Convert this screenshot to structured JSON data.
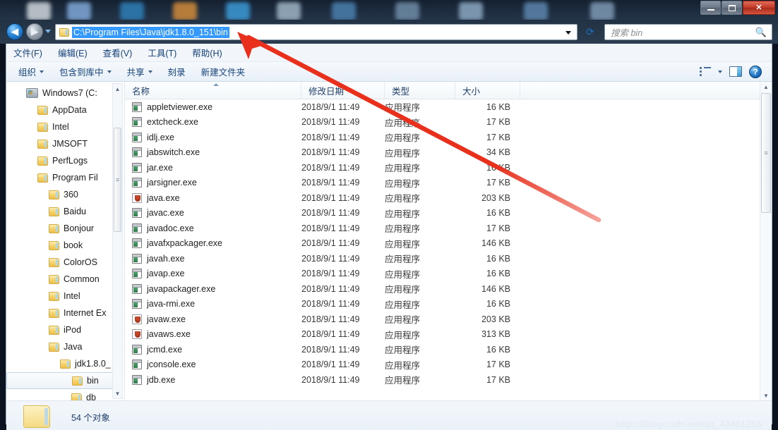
{
  "window": {
    "controls": {
      "minimize": "–",
      "maximize": "❐",
      "close": "✕"
    }
  },
  "address_bar": {
    "back_label": "◀",
    "forward_label": "▶",
    "path": "C:\\Program Files\\Java\\jdk1.8.0_151\\bin",
    "refresh_label": "⟳",
    "folder_icon": "folder-icon",
    "dropdown_icon": "chevron-down-icon"
  },
  "search": {
    "placeholder": "搜索 bin",
    "icon": "search-icon"
  },
  "menu": {
    "items": [
      {
        "label": "文件(F)"
      },
      {
        "label": "编辑(E)"
      },
      {
        "label": "查看(V)"
      },
      {
        "label": "工具(T)"
      },
      {
        "label": "帮助(H)"
      }
    ]
  },
  "toolbar": {
    "items": [
      {
        "label": "组织",
        "caret": true
      },
      {
        "label": "包含到库中",
        "caret": true
      },
      {
        "label": "共享",
        "caret": true
      },
      {
        "label": "刻录",
        "caret": false
      },
      {
        "label": "新建文件夹",
        "caret": false
      }
    ],
    "view_icon": "view-list-icon",
    "view_caret": "chevron-down-icon",
    "preview_pane_icon": "preview-pane-icon",
    "help_icon": "help-icon",
    "help_glyph": "?"
  },
  "sidebar": {
    "items": [
      {
        "label": "Windows7 (C:",
        "type": "drive",
        "indent": 0,
        "selected": false
      },
      {
        "label": "AppData",
        "type": "folder",
        "indent": 1,
        "selected": false
      },
      {
        "label": "Intel",
        "type": "folder",
        "indent": 1,
        "selected": false
      },
      {
        "label": "JMSOFT",
        "type": "folder",
        "indent": 1,
        "selected": false
      },
      {
        "label": "PerfLogs",
        "type": "folder",
        "indent": 1,
        "selected": false
      },
      {
        "label": "Program Fil",
        "type": "folder",
        "indent": 1,
        "selected": false
      },
      {
        "label": "360",
        "type": "folder",
        "indent": 2,
        "selected": false
      },
      {
        "label": "Baidu",
        "type": "folder",
        "indent": 2,
        "selected": false
      },
      {
        "label": "Bonjour",
        "type": "folder",
        "indent": 2,
        "selected": false
      },
      {
        "label": "book",
        "type": "folder",
        "indent": 2,
        "selected": false
      },
      {
        "label": "ColorOS",
        "type": "folder",
        "indent": 2,
        "selected": false
      },
      {
        "label": "Common ",
        "type": "folder",
        "indent": 2,
        "selected": false
      },
      {
        "label": "Intel",
        "type": "folder",
        "indent": 2,
        "selected": false
      },
      {
        "label": "Internet Ex",
        "type": "folder",
        "indent": 2,
        "selected": false
      },
      {
        "label": "iPod",
        "type": "folder",
        "indent": 2,
        "selected": false
      },
      {
        "label": "Java",
        "type": "folder",
        "indent": 2,
        "selected": false
      },
      {
        "label": "jdk1.8.0_",
        "type": "folder",
        "indent": 3,
        "selected": false
      },
      {
        "label": "bin",
        "type": "folder",
        "indent": 4,
        "selected": true
      },
      {
        "label": "db",
        "type": "folder",
        "indent": 4,
        "selected": false
      }
    ]
  },
  "file_list": {
    "columns": [
      {
        "label": "名称",
        "sorted": true
      },
      {
        "label": "修改日期",
        "sorted": false
      },
      {
        "label": "类型",
        "sorted": false
      },
      {
        "label": "大小",
        "sorted": false
      }
    ],
    "rows": [
      {
        "name": "appletviewer.exe",
        "date": "2018/9/1 11:49",
        "type": "应用程序",
        "size": "16 KB",
        "icon": "exe"
      },
      {
        "name": "extcheck.exe",
        "date": "2018/9/1 11:49",
        "type": "应用程序",
        "size": "17 KB",
        "icon": "exe"
      },
      {
        "name": "idlj.exe",
        "date": "2018/9/1 11:49",
        "type": "应用程序",
        "size": "17 KB",
        "icon": "exe"
      },
      {
        "name": "jabswitch.exe",
        "date": "2018/9/1 11:49",
        "type": "应用程序",
        "size": "34 KB",
        "icon": "exe"
      },
      {
        "name": "jar.exe",
        "date": "2018/9/1 11:49",
        "type": "应用程序",
        "size": "16 KB",
        "icon": "exe"
      },
      {
        "name": "jarsigner.exe",
        "date": "2018/9/1 11:49",
        "type": "应用程序",
        "size": "17 KB",
        "icon": "exe"
      },
      {
        "name": "java.exe",
        "date": "2018/9/1 11:49",
        "type": "应用程序",
        "size": "203 KB",
        "icon": "java"
      },
      {
        "name": "javac.exe",
        "date": "2018/9/1 11:49",
        "type": "应用程序",
        "size": "16 KB",
        "icon": "exe"
      },
      {
        "name": "javadoc.exe",
        "date": "2018/9/1 11:49",
        "type": "应用程序",
        "size": "17 KB",
        "icon": "exe"
      },
      {
        "name": "javafxpackager.exe",
        "date": "2018/9/1 11:49",
        "type": "应用程序",
        "size": "146 KB",
        "icon": "exe"
      },
      {
        "name": "javah.exe",
        "date": "2018/9/1 11:49",
        "type": "应用程序",
        "size": "16 KB",
        "icon": "exe"
      },
      {
        "name": "javap.exe",
        "date": "2018/9/1 11:49",
        "type": "应用程序",
        "size": "16 KB",
        "icon": "exe"
      },
      {
        "name": "javapackager.exe",
        "date": "2018/9/1 11:49",
        "type": "应用程序",
        "size": "146 KB",
        "icon": "exe"
      },
      {
        "name": "java-rmi.exe",
        "date": "2018/9/1 11:49",
        "type": "应用程序",
        "size": "16 KB",
        "icon": "exe"
      },
      {
        "name": "javaw.exe",
        "date": "2018/9/1 11:49",
        "type": "应用程序",
        "size": "203 KB",
        "icon": "java"
      },
      {
        "name": "javaws.exe",
        "date": "2018/9/1 11:49",
        "type": "应用程序",
        "size": "313 KB",
        "icon": "java"
      },
      {
        "name": "jcmd.exe",
        "date": "2018/9/1 11:49",
        "type": "应用程序",
        "size": "16 KB",
        "icon": "exe"
      },
      {
        "name": "jconsole.exe",
        "date": "2018/9/1 11:49",
        "type": "应用程序",
        "size": "17 KB",
        "icon": "exe"
      },
      {
        "name": "jdb.exe",
        "date": "2018/9/1 11:49",
        "type": "应用程序",
        "size": "17 KB",
        "icon": "exe"
      }
    ]
  },
  "status_bar": {
    "text": "54 个对象",
    "folder_icon": "folder-icon"
  },
  "watermark": {
    "text": "https://blog.csdn.net/qq_43481265"
  },
  "annotation": {
    "color": "#e8301c",
    "type": "arrow"
  },
  "colors": {
    "selection_blue": "#3399ff",
    "menu_text": "#16427a",
    "close_red": "#c23b28"
  }
}
